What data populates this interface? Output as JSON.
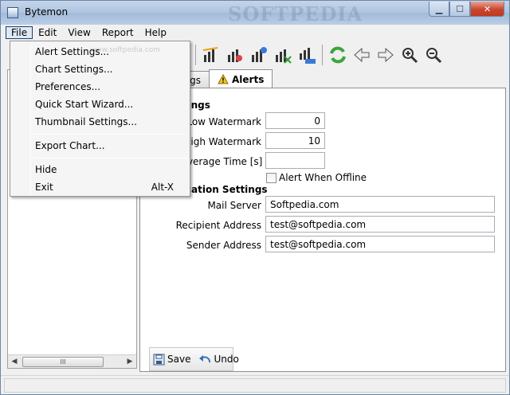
{
  "window": {
    "title": "Bytemon",
    "watermark": "SOFTPEDIA"
  },
  "menubar": [
    "File",
    "Edit",
    "View",
    "Report",
    "Help"
  ],
  "file_menu": {
    "items": [
      {
        "label": "Alert Settings..."
      },
      {
        "label": "Chart Settings..."
      },
      {
        "label": "Preferences..."
      },
      {
        "label": "Quick Start Wizard..."
      },
      {
        "label": "Thumbnail Settings..."
      },
      {
        "label": "Export Chart..."
      },
      {
        "label": "Hide"
      },
      {
        "label": "Exit",
        "shortcut": "Alt-X"
      }
    ],
    "watermark": "www.softpedia.com"
  },
  "tabs": {
    "inactive": "gs",
    "active": "Alerts"
  },
  "alerts": {
    "section1": "ttings",
    "low_label": "Low Watermark",
    "low_value": "0",
    "high_label": "High Watermark",
    "high_value": "10",
    "avg_label": "g Average Time [s]",
    "avg_value": "",
    "offline_label": "Alert When Offline",
    "section2": "fication Settings",
    "mail_label": "Mail Server",
    "mail_value": "Softpedia.com",
    "recipient_label": "Recipient Address",
    "recipient_value": "test@softpedia.com",
    "sender_label": "Sender Address",
    "sender_value": "test@softpedia.com"
  },
  "bottom": {
    "save": "Save",
    "undo": "Undo"
  },
  "scroll_thumb": "III"
}
